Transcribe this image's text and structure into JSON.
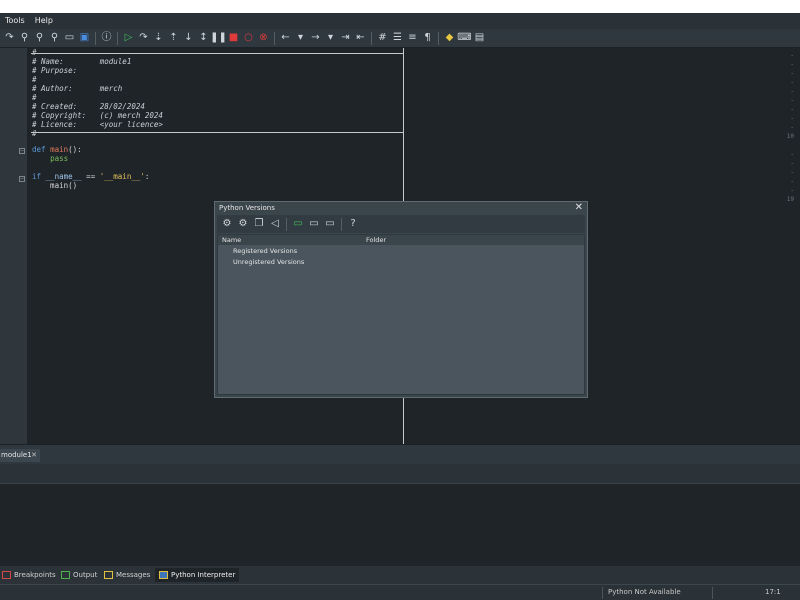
{
  "menu": [
    "Tools",
    "Help"
  ],
  "toolbar_icons": [
    "redo-icon",
    "find-icon",
    "find-next-icon",
    "replace-icon",
    "open-folder-icon",
    "module-icon",
    "info-icon",
    "run-icon",
    "step-over-icon",
    "step-into-icon",
    "step-out-icon",
    "run-to-cursor-icon",
    "pause-icon",
    "stop-icon",
    "breakpoint-icon",
    "clear-breakpoints-icon",
    "back-icon",
    "forward-icon",
    "indent-icon",
    "outdent-icon",
    "comment-icon",
    "list-icon",
    "wrap-icon",
    "pilcrow-icon",
    "python-icon",
    "keyboard-icon",
    "layout-icon"
  ],
  "editor": {
    "line_numbers": [
      {
        "label": "-",
        "row": 1
      },
      {
        "label": "-",
        "row": 2
      },
      {
        "label": "-",
        "row": 3
      },
      {
        "label": "-",
        "row": 4
      },
      {
        "label": "-",
        "row": 5
      },
      {
        "label": "-",
        "row": 6
      },
      {
        "label": "-",
        "row": 7
      },
      {
        "label": "-",
        "row": 8
      },
      {
        "label": "-",
        "row": 9
      },
      {
        "label": "10",
        "row": 10
      },
      {
        "label": "-",
        "row": 12
      },
      {
        "label": "-",
        "row": 13
      },
      {
        "label": "-",
        "row": 14
      },
      {
        "label": "-",
        "row": 15
      },
      {
        "label": "-",
        "row": 16
      },
      {
        "label": "19",
        "row": 17
      }
    ],
    "header_lines": [
      "#",
      "# Name:        module1",
      "# Purpose:",
      "#",
      "# Author:      merch",
      "#",
      "# Created:     28/02/2024",
      "# Copyright:   (c) merch 2024",
      "# Licence:     <your licence>",
      "#"
    ],
    "def_kw": "def",
    "def_name": "main",
    "def_rest": "():",
    "pass_kw": "pass",
    "if_kw": "if",
    "if_name": "__name__",
    "if_op": " == ",
    "if_str": "'__main__'",
    "if_colon": ":",
    "call": "main()"
  },
  "dialog": {
    "title": "Python Versions",
    "close": "✕",
    "col_name": "Name",
    "col_folder": "Folder",
    "rows": [
      "Registered Versions",
      "Unregistered Versions"
    ],
    "icons": [
      "gear-icon",
      "gear-add-icon",
      "copy-icon",
      "speaker-icon",
      "console-icon",
      "folder-icon",
      "window-icon",
      "help-icon"
    ]
  },
  "doc_tab": {
    "label": "module1",
    "close": "✕"
  },
  "panel_tabs": {
    "breakpoints": "Breakpoints",
    "output": "Output",
    "messages": "Messages",
    "python_interpreter": "Python Interpreter"
  },
  "status": {
    "python": "Python Not Available",
    "position": "17:1"
  }
}
